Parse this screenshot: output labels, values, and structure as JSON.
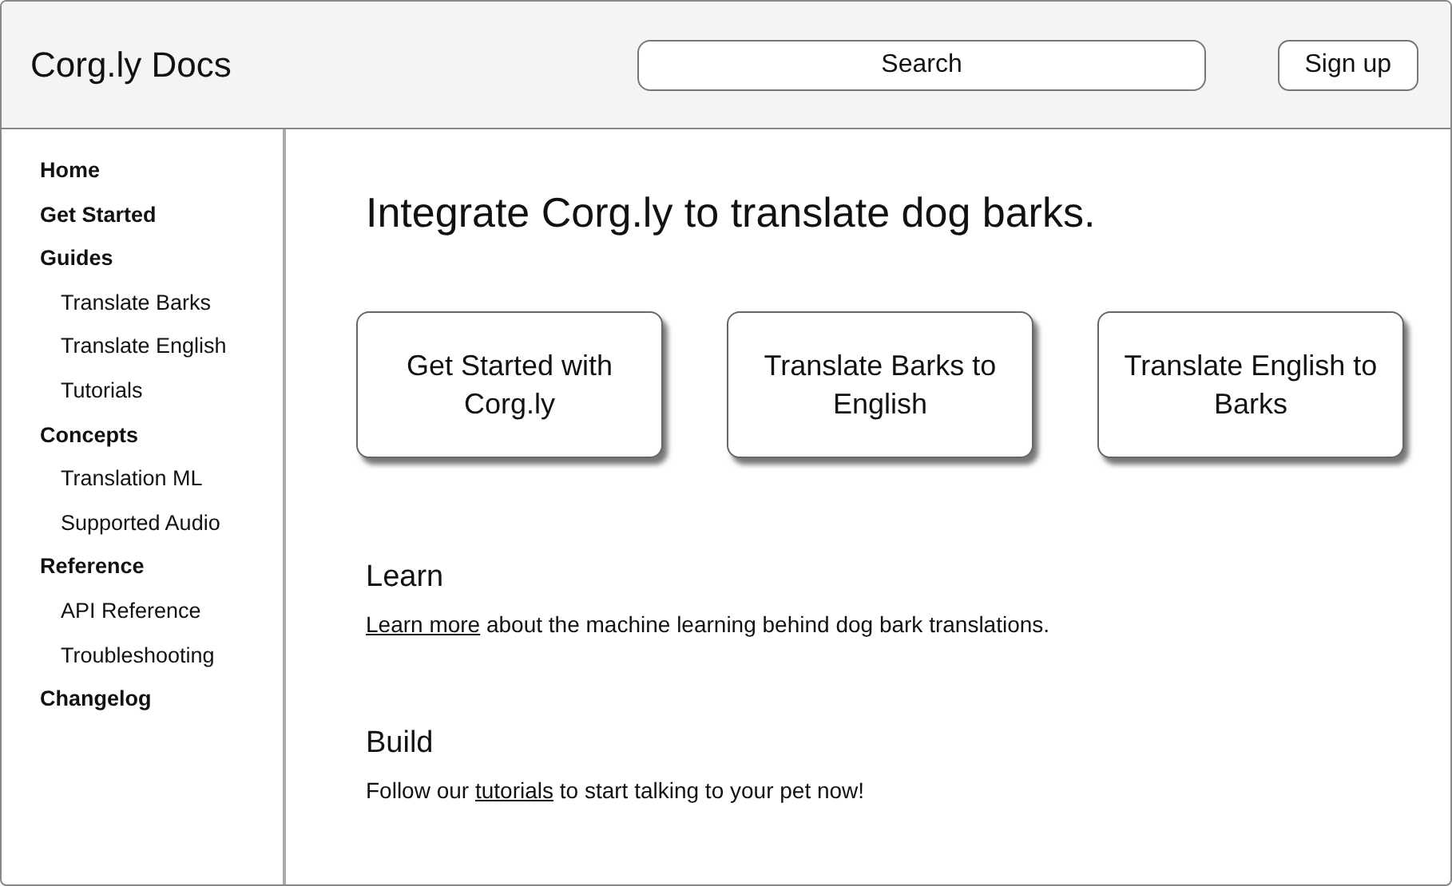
{
  "header": {
    "title": "Corg.ly Docs",
    "search": {
      "placeholder": "Search"
    },
    "button": "Sign up"
  },
  "sidebar": {
    "items": [
      {
        "label": "Home"
      },
      {
        "label": "Get Started"
      },
      {
        "label": "Guides",
        "children": [
          {
            "label": "Translate Barks"
          },
          {
            "label": "Translate English"
          },
          {
            "label": "Tutorials"
          }
        ]
      },
      {
        "label": "Concepts",
        "children": [
          {
            "label": "Translation ML"
          },
          {
            "label": "Supported Audio"
          }
        ]
      },
      {
        "label": "Reference",
        "children": [
          {
            "label": "API Reference"
          },
          {
            "label": "Troubleshooting"
          }
        ]
      },
      {
        "label": "Changelog"
      }
    ]
  },
  "main": {
    "heading": "Integrate Corg.ly to translate dog barks.",
    "cards": [
      "Get Started with Corg.ly",
      "Translate Barks to English",
      "Translate English to Barks"
    ],
    "sections": [
      {
        "heading": "Learn",
        "link": "Learn more",
        "after": " about the machine learning behind dog bark translations."
      },
      {
        "heading": "Build",
        "before": "Follow our ",
        "link": "tutorials",
        "after": " to start talking to your pet now!"
      }
    ]
  }
}
